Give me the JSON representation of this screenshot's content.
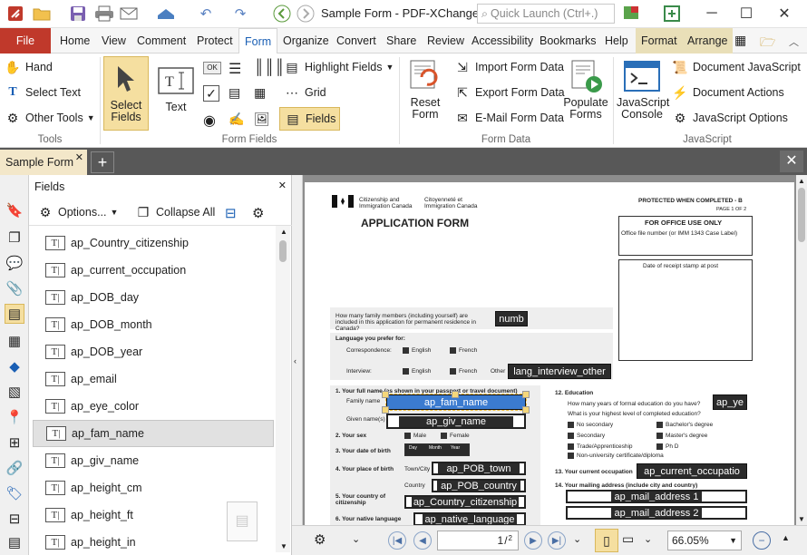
{
  "window": {
    "title": "Sample Form - PDF-XChange E...",
    "quick_launch_placeholder": "Quick Launch (Ctrl+.)"
  },
  "menu_tabs": [
    "File",
    "Home",
    "View",
    "Comment",
    "Protect",
    "Form",
    "Organize",
    "Convert",
    "Share",
    "Review",
    "Accessibility",
    "Bookmarks",
    "Help",
    "Format",
    "Arrange"
  ],
  "ribbon": {
    "tools": {
      "label": "Tools",
      "hand": "Hand",
      "select_text": "Select Text",
      "other_tools": "Other Tools"
    },
    "form_fields": {
      "label": "Form Fields",
      "select_fields": "Select Fields",
      "text": "Text",
      "highlight_fields": "Highlight Fields",
      "grid": "Grid",
      "fields": "Fields",
      "ok_button": "OK"
    },
    "form_data": {
      "label": "Form Data",
      "reset_form": "Reset Form",
      "import_form_data": "Import Form Data",
      "export_form_data": "Export Form Data",
      "email_form_data": "E-Mail Form Data",
      "populate_forms": "Populate Forms"
    },
    "javascript": {
      "label": "JavaScript",
      "console": "JavaScript Console",
      "document_javascript": "Document JavaScript",
      "document_actions": "Document Actions",
      "javascript_options": "JavaScript Options"
    }
  },
  "doc_tab": {
    "name": "Sample Form"
  },
  "fields_panel": {
    "title": "Fields",
    "options_label": "Options...",
    "collapse_all_label": "Collapse All",
    "items": [
      "ap_Country_citizenship",
      "ap_current_occupation",
      "ap_DOB_day",
      "ap_DOB_month",
      "ap_DOB_year",
      "ap_email",
      "ap_eye_color",
      "ap_fam_name",
      "ap_giv_name",
      "ap_height_cm",
      "ap_height_ft",
      "ap_height_in"
    ],
    "selected": "ap_fam_name"
  },
  "pdf": {
    "header_en": "Citizenship and Immigration Canada",
    "header_fr": "Citoyenneté et Immigration Canada",
    "protected": "PROTECTED WHEN COMPLETED - B",
    "page_of": "PAGE 1 OF 2",
    "form_title": "APPLICATION FORM",
    "office_use": "FOR OFFICE USE ONLY",
    "office_file": "Office file number (or IMM 1343 Case Label)",
    "date_receipt": "Date of receipt stamp at post",
    "family_members_q": "How many family members (including yourself) are included in this application for permanent residence in Canada?",
    "lang_pref": "Language you prefer for:",
    "correspondence": "Correspondence:",
    "interview": "Interview:",
    "english": "English",
    "french": "French",
    "other": "Other",
    "full_name": "1.   Your full name (as shown in your passport or travel document)",
    "family_name": "Family name",
    "given_names": "Given name(s)",
    "your_sex": "2.   Your sex",
    "male": "Male",
    "female": "Female",
    "dob": "3.   Your date of birth",
    "dob_cols": [
      "Day",
      "Month",
      "Year"
    ],
    "place_birth": "4.   Your place of birth",
    "town_city": "Town/City",
    "country": "Country",
    "country_citizenship": "5.   Your country of citizenship",
    "native_language": "6.   Your native language",
    "education": "12.  Education",
    "years_edu": "How many years of formal education do you have?",
    "highest_edu": "What is your highest level of completed education?",
    "edu_opts": [
      "No secondary",
      "Secondary",
      "Trade/Apprenticeship",
      "Non-university certificate/diploma",
      "Bachelor's degree",
      "Master's degree",
      "Ph D"
    ],
    "current_occ": "13.  Your current occupation",
    "mailing": "14.  Your mailing address (include city and country)",
    "fields": {
      "numb": "numb",
      "lang_interview_other": "lang_interview_other",
      "ap_fam_name": "ap_fam_name",
      "ap_giv_name": "ap_giv_name",
      "ap_POB_town": "ap_POB_town",
      "ap_POB_country": "ap_POB_country",
      "ap_Country_citizenship": "ap_Country_citizenship",
      "ap_native_language": "ap_native_language",
      "ap_ye": "ap_ye",
      "ap_current_occupation": "ap_current_occupatio",
      "ap_mail_address_1": "ap_mail_address 1",
      "ap_mail_address_2": "ap_mail_address 2"
    }
  },
  "statusbar": {
    "page_current": "1",
    "page_total": "2",
    "zoom": "66.05%"
  },
  "colors": {
    "file_tab": "#c0392b",
    "doc_tab": "#f3e7c9",
    "selected_field": "#3b7bd0",
    "accent": "#1a5fb4"
  }
}
